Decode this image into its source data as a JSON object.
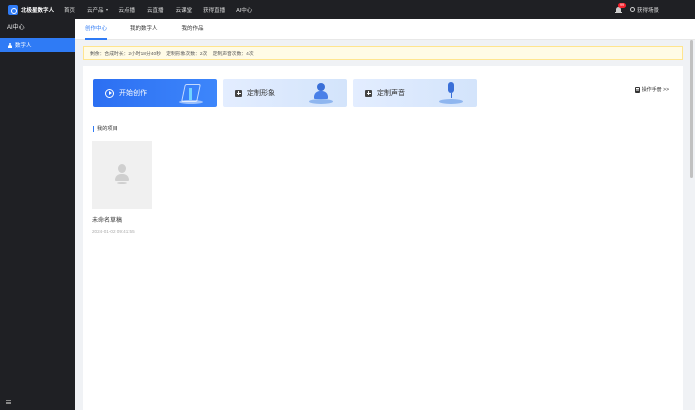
{
  "app": {
    "logo_text": "北极星数字人"
  },
  "topnav": {
    "items": [
      {
        "label": "首页",
        "has_caret": false
      },
      {
        "label": "云产品",
        "has_caret": true
      },
      {
        "label": "云点播",
        "has_caret": false
      },
      {
        "label": "云直播",
        "has_caret": false
      },
      {
        "label": "云课堂",
        "has_caret": false
      },
      {
        "label": "获得直播",
        "has_caret": false
      },
      {
        "label": "AI中心",
        "has_caret": false
      }
    ],
    "notification_count": "99",
    "user_name": "获得场景"
  },
  "sidebar": {
    "title": "AI中心",
    "items": [
      {
        "label": "数字人",
        "active": true
      }
    ]
  },
  "tabs": [
    {
      "label": "创作中心",
      "active": true
    },
    {
      "label": "我的数字人",
      "active": false
    },
    {
      "label": "我的作品",
      "active": false
    }
  ],
  "notice": {
    "text": "剩余：合成时长：2小时18分40秒    定制形象次数：2次    定制声音次数：4次"
  },
  "cards": {
    "start": {
      "label": "开始创作"
    },
    "avatar": {
      "label": "定制形象"
    },
    "voice": {
      "label": "定制声音"
    }
  },
  "manual_link": "操作手册 >>",
  "projects": {
    "section_title": "我的项目",
    "items": [
      {
        "name": "未命名草稿",
        "date": "2024-01-02 09:41:55"
      }
    ]
  },
  "colors": {
    "accent": "#2f7bf5",
    "topbar": "#1f2024",
    "notice_bg": "#fffbe6"
  }
}
